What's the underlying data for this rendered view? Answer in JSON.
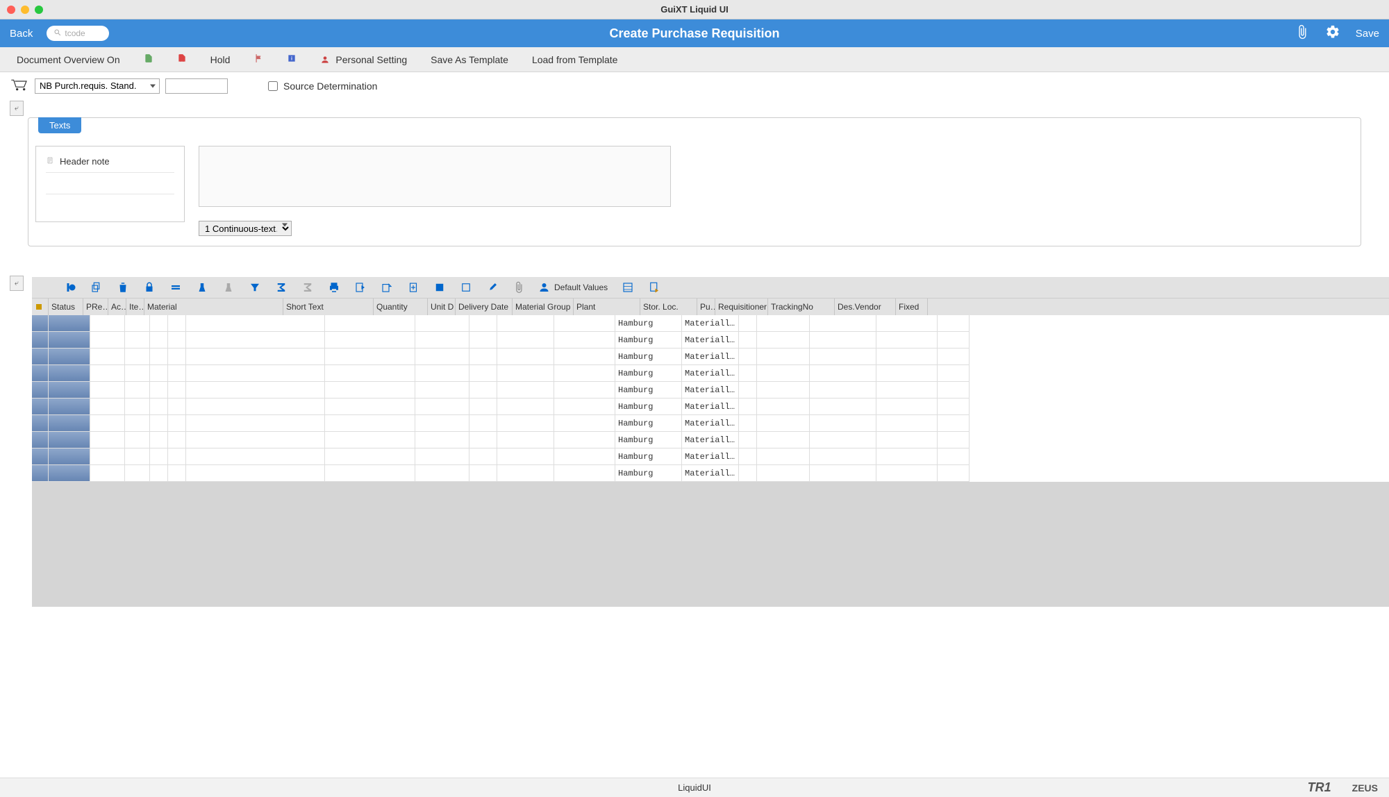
{
  "window_title": "GuiXT Liquid UI",
  "header": {
    "back": "Back",
    "search_placeholder": "tcode",
    "title": "Create Purchase Requisition",
    "save": "Save"
  },
  "toolbar": {
    "doc_overview": "Document Overview On",
    "hold": "Hold",
    "personal_setting": "Personal Setting",
    "save_template": "Save As Template",
    "load_template": "Load from Template"
  },
  "doc": {
    "type_selected": "NB Purch.requis. Stand.",
    "number": "",
    "source_determination_label": "Source Determination"
  },
  "tabs": {
    "texts": "Texts"
  },
  "texts": {
    "header_note": "Header note",
    "format_selected": "1 Continuous-text…"
  },
  "alv": {
    "default_values": "Default Values"
  },
  "columns": {
    "sel_icon": "",
    "status": "Status",
    "pre": "PRe…",
    "ac": "Ac…",
    "ite": "Ite…",
    "material": "Material",
    "short_text": "Short Text",
    "quantity": "Quantity",
    "unit": "Unit D",
    "delivery_date": "Delivery Date",
    "material_group": "Material Group",
    "plant": "Plant",
    "stor_loc": "Stor. Loc.",
    "pu": "Pu…",
    "requisitioner": "Requisitioner",
    "tracking": "TrackingNo",
    "vendor": "Des.Vendor",
    "fixed": "Fixed"
  },
  "rows": [
    {
      "plant": "Hamburg",
      "stor": "Materiall…"
    },
    {
      "plant": "Hamburg",
      "stor": "Materiall…"
    },
    {
      "plant": "Hamburg",
      "stor": "Materiall…"
    },
    {
      "plant": "Hamburg",
      "stor": "Materiall…"
    },
    {
      "plant": "Hamburg",
      "stor": "Materiall…"
    },
    {
      "plant": "Hamburg",
      "stor": "Materiall…"
    },
    {
      "plant": "Hamburg",
      "stor": "Materiall…"
    },
    {
      "plant": "Hamburg",
      "stor": "Materiall…"
    },
    {
      "plant": "Hamburg",
      "stor": "Materiall…"
    },
    {
      "plant": "Hamburg",
      "stor": "Materiall…"
    }
  ],
  "footer": {
    "branding": "LiquidUI",
    "system": "TR1",
    "user": "ZEUS"
  }
}
